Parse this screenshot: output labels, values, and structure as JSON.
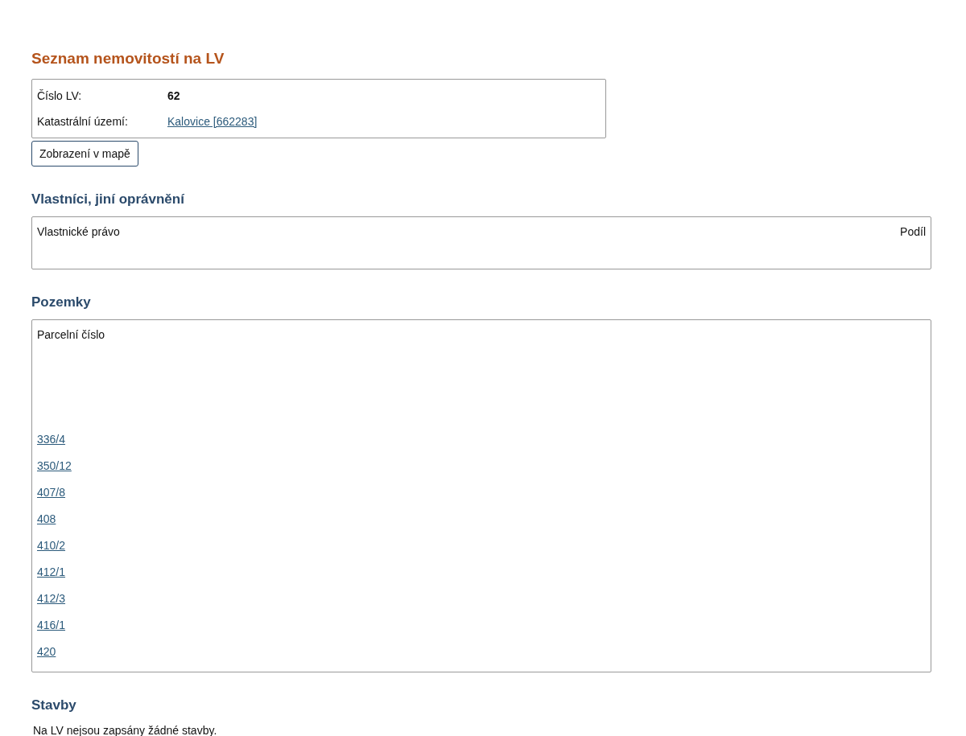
{
  "title": "Seznam nemovitostí na LV",
  "info": [
    {
      "label": "Číslo LV:",
      "value": "62",
      "kind": "text"
    },
    {
      "label": "Katastrální území:",
      "value": "Kalovice [662283]",
      "kind": "link"
    }
  ],
  "map_button": "Zobrazení v mapě",
  "owners": {
    "heading": "Vlastníci, jiní oprávnění",
    "columns": [
      "Vlastnické právo",
      "Podíl"
    ]
  },
  "parcels": {
    "heading": "Pozemky",
    "column": "Parcelní číslo",
    "rows": [
      "336/4",
      "350/12",
      "407/8",
      "408",
      "410/2",
      "412/1",
      "412/3",
      "416/1",
      "420"
    ]
  },
  "buildings": {
    "heading": "Stavby",
    "note": "Na LV nejsou zapsány žádné stavby."
  }
}
